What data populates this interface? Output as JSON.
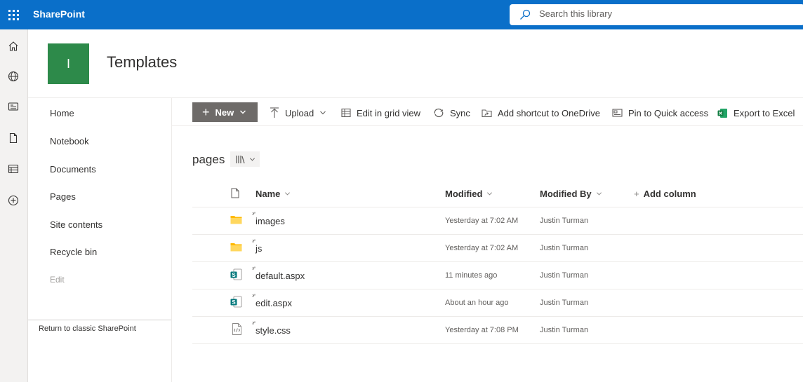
{
  "suitebar": {
    "app_name": "SharePoint",
    "search_placeholder": "Search this library"
  },
  "site": {
    "logo_letter": "I",
    "title": "Templates"
  },
  "nav": {
    "items": [
      "Home",
      "Notebook",
      "Documents",
      "Pages",
      "Site contents",
      "Recycle bin"
    ],
    "edit_label": "Edit",
    "classic_link": "Return to classic SharePoint"
  },
  "commands": {
    "new_label": "New",
    "upload": "Upload",
    "grid": "Edit in grid view",
    "sync": "Sync",
    "shortcut": "Add shortcut to OneDrive",
    "pin": "Pin to Quick access",
    "export": "Export to Excel"
  },
  "library": {
    "title": "pages",
    "columns": {
      "name": "Name",
      "modified": "Modified",
      "modified_by": "Modified By",
      "add_column": "Add column"
    },
    "rows": [
      {
        "name": "images",
        "type": "folder",
        "modified": "Yesterday at 7:02 AM",
        "modified_by": "Justin Turman"
      },
      {
        "name": "js",
        "type": "folder",
        "modified": "Yesterday at 7:02 AM",
        "modified_by": "Justin Turman"
      },
      {
        "name": "default.aspx",
        "type": "aspx",
        "modified": "11 minutes ago",
        "modified_by": "Justin Turman"
      },
      {
        "name": "edit.aspx",
        "type": "aspx",
        "modified": "About an hour ago",
        "modified_by": "Justin Turman"
      },
      {
        "name": "style.css",
        "type": "css",
        "modified": "Yesterday at 7:08 PM",
        "modified_by": "Justin Turman"
      }
    ]
  },
  "colors": {
    "suitebar": "#0a6fc9",
    "site_logo": "#2d8a4a",
    "new_button": "#6e6b69",
    "folder": "#ffb900",
    "sharepoint_file": "#03787c",
    "excel": "#107c41"
  }
}
